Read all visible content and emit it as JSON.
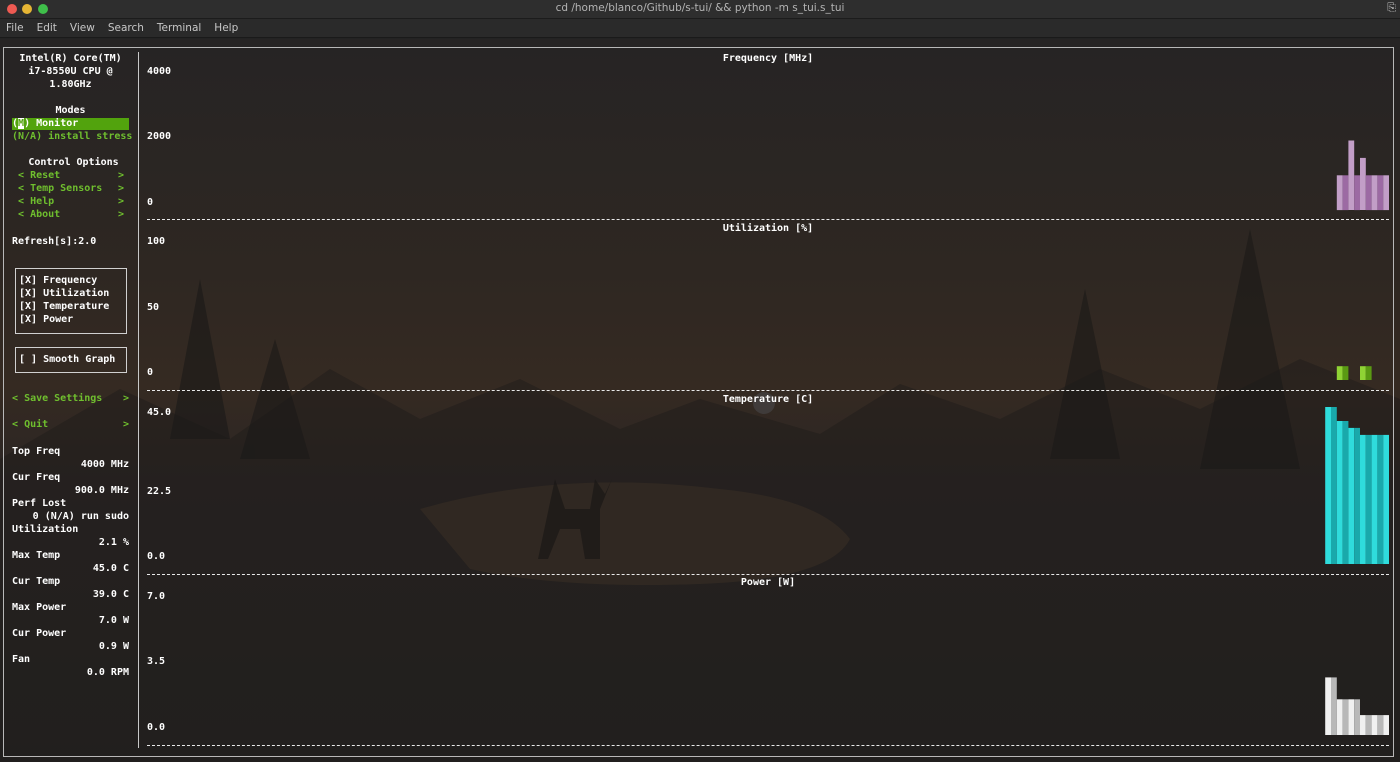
{
  "window": {
    "title": "cd /home/blanco/Github/s-tui/ && python -m s_tui.s_tui",
    "corner_icon": "terminal-icon"
  },
  "menu": [
    "File",
    "Edit",
    "View",
    "Search",
    "Terminal",
    "Help"
  ],
  "sidebar": {
    "cpu_line1": "Intel(R) Core(TM)",
    "cpu_line2": "i7-8550U CPU @",
    "cpu_line3": "1.80GHz",
    "modes_title": "Modes",
    "mode_monitor_mark": "M",
    "mode_monitor_label": "Monitor",
    "mode_stress_label": "(N/A) install stress",
    "control_title": "Control Options",
    "controls": [
      "Reset",
      "Temp Sensors",
      "Help",
      "About"
    ],
    "refresh": "Refresh[s]:2.0",
    "graph_toggles": [
      "[X] Frequency",
      "[X] Utilization",
      "[X] Temperature",
      "[X] Power"
    ],
    "smooth_graph": "[ ] Smooth Graph",
    "save_settings": "Save Settings",
    "quit": "Quit",
    "arrow_left": "<",
    "arrow_right": ">",
    "stats": [
      {
        "label": "Top Freq",
        "value": "4000 MHz"
      },
      {
        "label": "Cur Freq",
        "value": "900.0 MHz"
      },
      {
        "label": "Perf Lost",
        "value": "0 (N/A) run sudo"
      },
      {
        "label": "Utilization",
        "value": "2.1 %"
      },
      {
        "label": "Max Temp",
        "value": "45.0 C"
      },
      {
        "label": "Cur Temp",
        "value": "39.0 C"
      },
      {
        "label": "Max Power",
        "value": "7.0 W"
      },
      {
        "label": "Cur Power",
        "value": "0.9 W"
      },
      {
        "label": "Fan",
        "value": "0.0 RPM"
      }
    ]
  },
  "graphs": {
    "frequency": {
      "title": "Frequency [MHz]",
      "tick_top": "4000",
      "tick_mid": "2000",
      "tick_bot": "0",
      "ymax": 4000,
      "color_a": "#c29ec7",
      "color_b": "#9c6aa3",
      "values": [
        1000,
        1000,
        2000,
        1000,
        1500,
        1000,
        1000,
        1000,
        1000
      ]
    },
    "utilization": {
      "title": "Utilization [%]",
      "tick_top": "100",
      "tick_mid": "50",
      "tick_bot": "0",
      "ymax": 100,
      "color_a": "#8fd334",
      "color_b": "#5a9a13",
      "values": [
        10,
        10,
        0,
        0,
        10,
        10,
        0,
        0,
        0
      ]
    },
    "temperature": {
      "title": "Temperature [C]",
      "tick_top": "45.0",
      "tick_mid": "22.5",
      "tick_bot": "0.0",
      "ymax": 45,
      "color_a": "#2fdcdc",
      "color_b": "#19a9ab",
      "values": [
        45,
        45,
        41,
        41,
        39,
        39,
        37,
        37,
        37,
        37,
        37
      ]
    },
    "power": {
      "title": "Power [W]",
      "tick_top": "7.0",
      "tick_mid": "3.5",
      "tick_bot": "0.0",
      "ymax": 7,
      "color_a": "#f0f0f0",
      "color_b": "#b8b8b8",
      "values": [
        2.9,
        2.9,
        1.8,
        1.8,
        1.8,
        1.8,
        1.0,
        1.0,
        1.0,
        1.0,
        1.0
      ]
    }
  }
}
